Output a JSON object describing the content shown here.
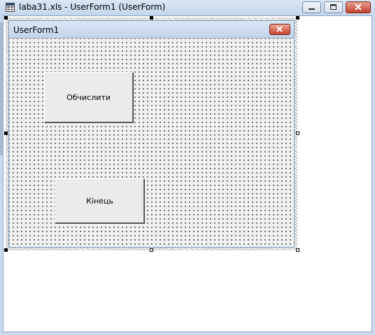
{
  "window": {
    "title": "laba31.xls - UserForm1 (UserForm)"
  },
  "userform": {
    "caption": "UserForm1"
  },
  "buttons": {
    "calculate": "Обчислити",
    "end": "Кінець"
  },
  "icons": {
    "app": "vba-form-icon",
    "minimize": "minimize-icon",
    "maximize": "maximize-icon",
    "close": "close-icon",
    "form_close": "close-icon"
  }
}
